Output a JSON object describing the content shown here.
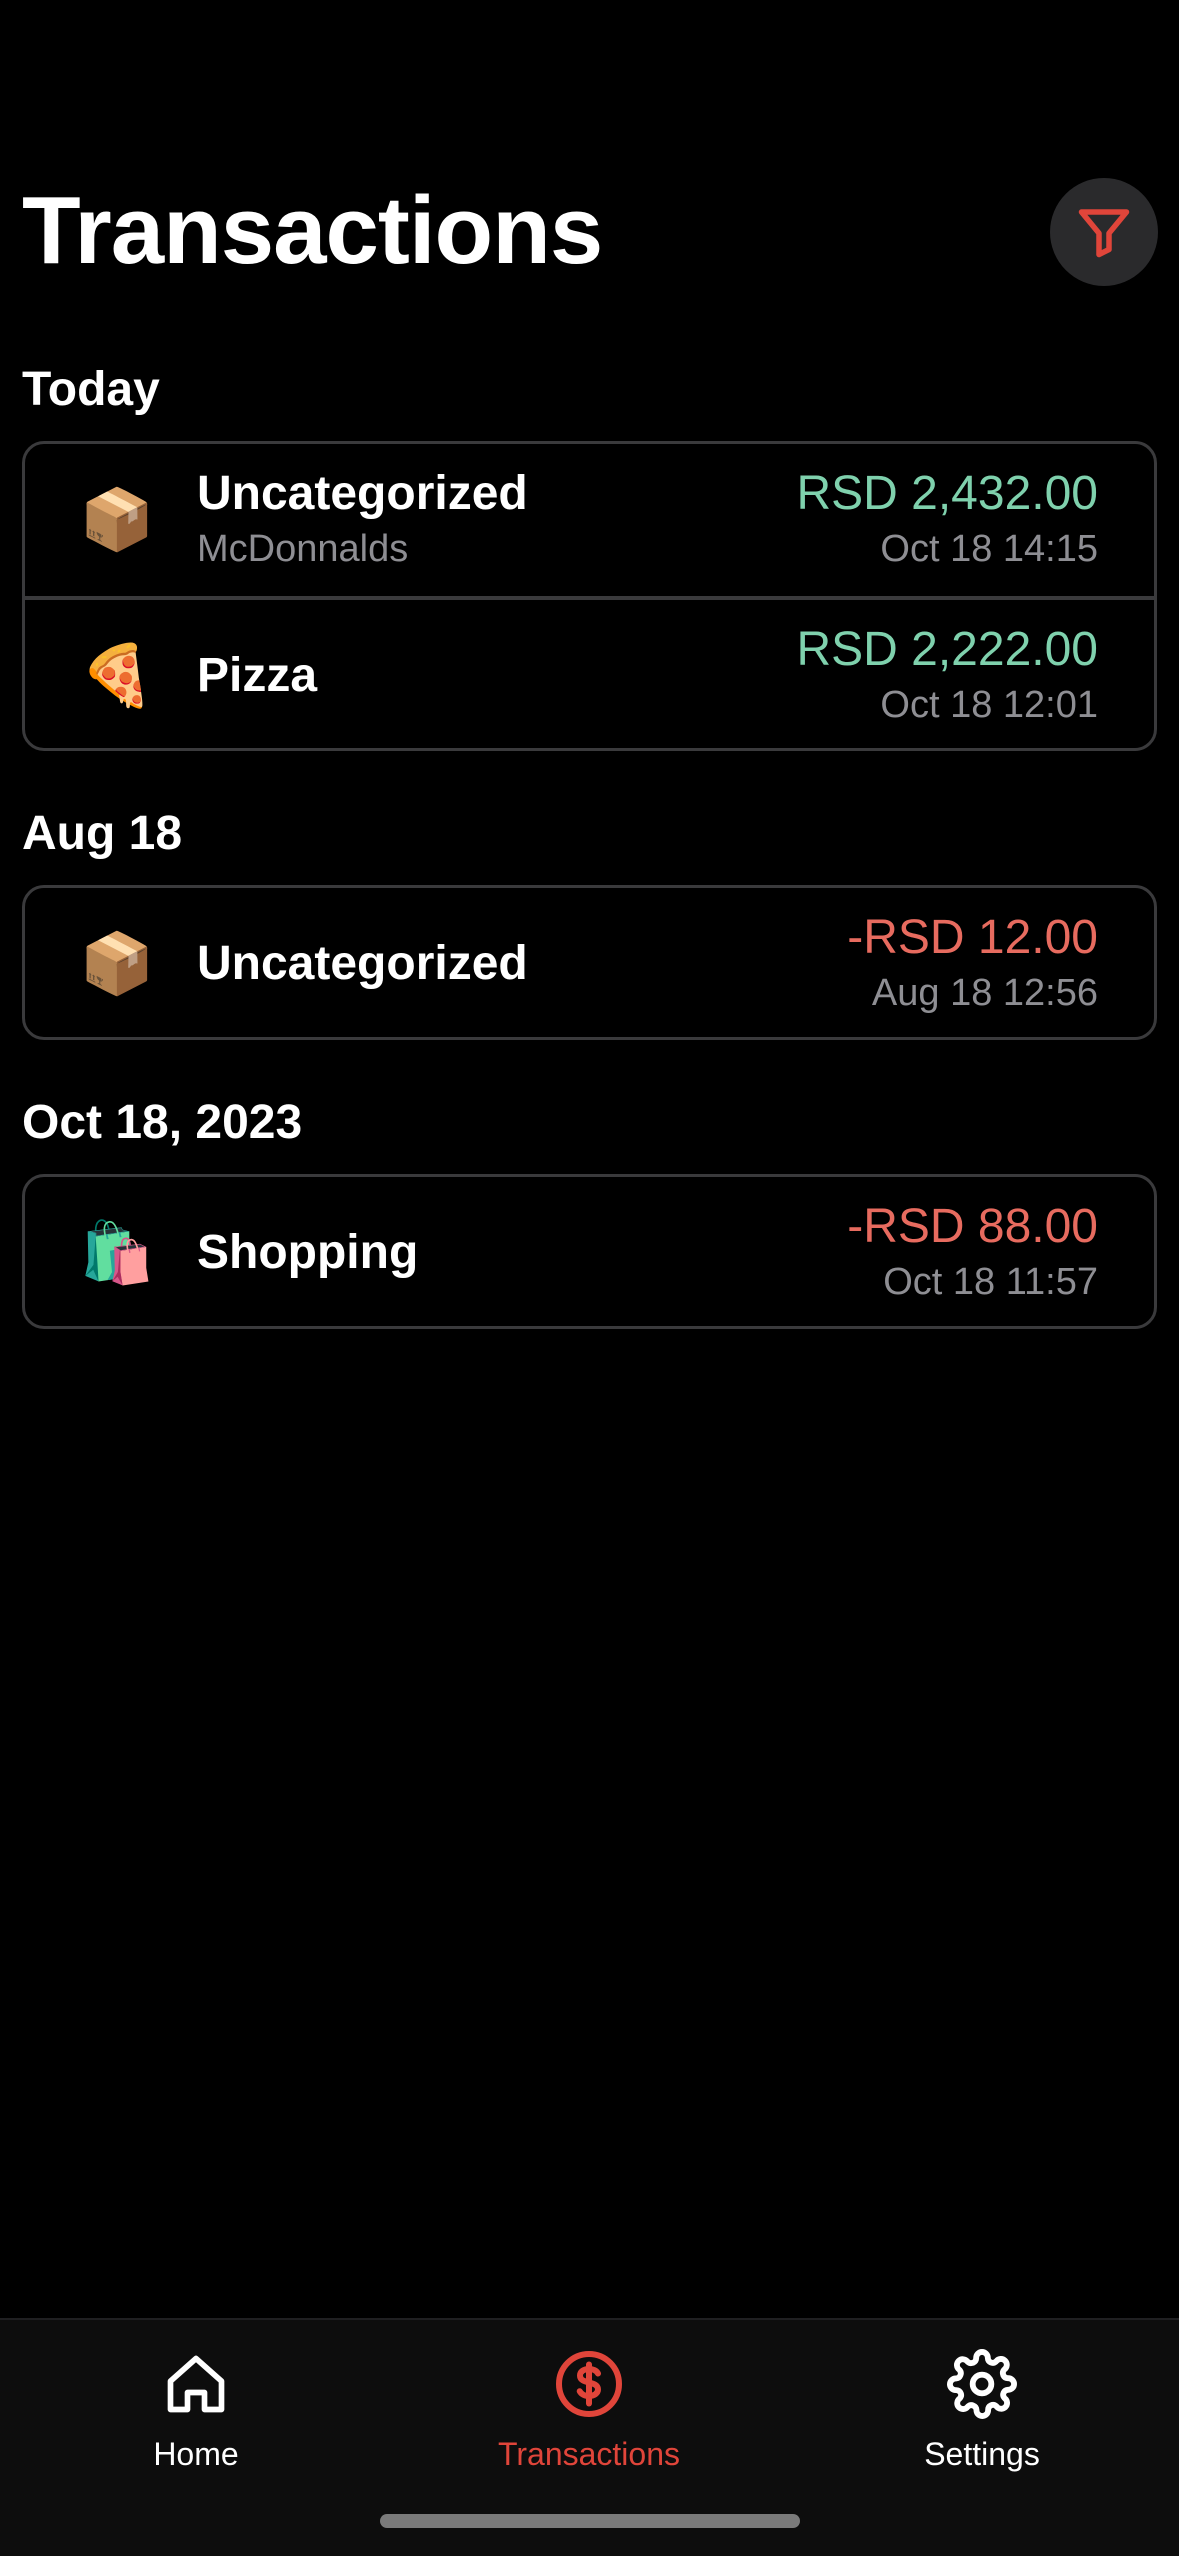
{
  "header": {
    "title": "Transactions"
  },
  "sections": [
    {
      "title": "Today",
      "items": [
        {
          "emoji": "📦",
          "category": "Uncategorized",
          "note": "McDonnalds",
          "amount": "RSD 2,432.00",
          "time": "Oct 18 14:15"
        },
        {
          "emoji": "🍕",
          "category": "Pizza",
          "note": "",
          "amount": "RSD 2,222.00",
          "time": "Oct 18 12:01"
        }
      ]
    },
    {
      "title": "Aug 18",
      "items": [
        {
          "emoji": "📦",
          "category": "Uncategorized",
          "note": "",
          "amount": "-RSD 12.00",
          "time": "Aug 18 12:56"
        }
      ]
    },
    {
      "title": "Oct 18, 2023",
      "items": [
        {
          "emoji": "🛍️",
          "category": "Shopping",
          "note": "",
          "amount": "-RSD 88.00",
          "time": "Oct 18 11:57"
        }
      ]
    }
  ],
  "tabs": [
    {
      "label": "Home",
      "icon": "home-icon"
    },
    {
      "label": "Transactions",
      "icon": "dollar-circle-icon"
    },
    {
      "label": "Settings",
      "icon": "gear-icon"
    }
  ],
  "colors": {
    "income": "#7fd1ad",
    "expense": "#e76b5f",
    "accent": "#e0453a",
    "muted": "#8e8e93"
  }
}
